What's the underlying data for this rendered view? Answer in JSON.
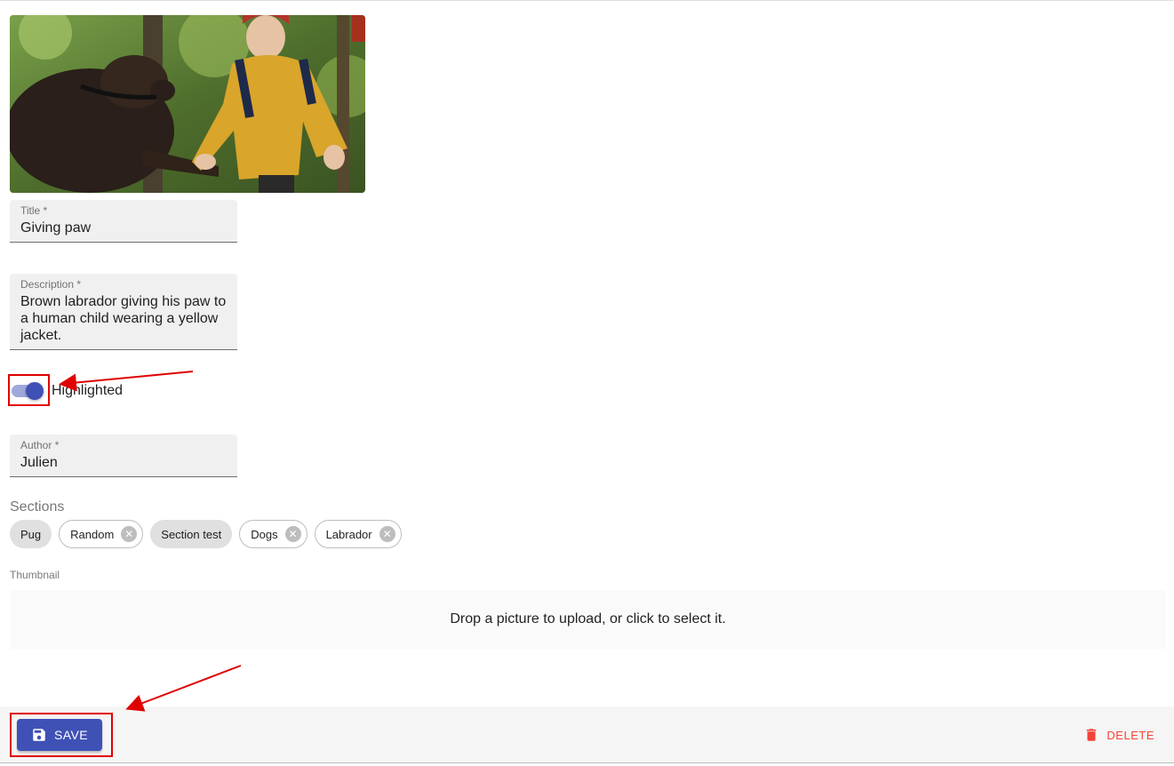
{
  "hero_image": {
    "alt": "Brown labrador giving paw to child"
  },
  "fields": {
    "title": {
      "label": "Title *",
      "value": "Giving paw"
    },
    "description": {
      "label": "Description *",
      "value": "Brown labrador giving his paw to a human child wearing a yellow jacket."
    },
    "author": {
      "label": "Author *",
      "value": "Julien"
    }
  },
  "highlighted": {
    "label": "Highlighted",
    "checked": true
  },
  "sections": {
    "label": "Sections",
    "chips": [
      {
        "label": "Pug",
        "deletable": false
      },
      {
        "label": "Random",
        "deletable": true
      },
      {
        "label": "Section test",
        "deletable": false
      },
      {
        "label": "Dogs",
        "deletable": true
      },
      {
        "label": "Labrador",
        "deletable": true
      }
    ]
  },
  "thumbnail": {
    "label": "Thumbnail",
    "dropzone_text": "Drop a picture to upload, or click to select it."
  },
  "toolbar": {
    "save_label": "SAVE",
    "save_icon": "save-icon",
    "delete_label": "DELETE",
    "delete_icon": "trash-icon"
  },
  "colors": {
    "primary": "#3f51b5",
    "danger": "#f44336",
    "annotation": "#e00000"
  }
}
